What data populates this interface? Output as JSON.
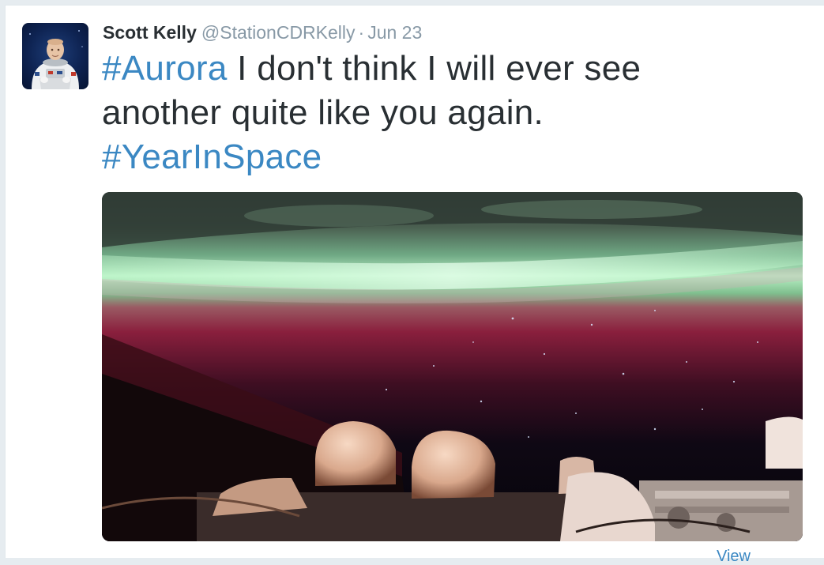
{
  "tweet": {
    "author_name": "Scott Kelly",
    "author_handle": "@StationCDRKelly",
    "separator": "·",
    "date": "Jun 23",
    "text_parts": {
      "hashtag_1": "#Aurora",
      "body": " I don't think I will ever see another quite like you again.",
      "hashtag_2": "#YearInSpace"
    },
    "media_kind": "aurora-photo",
    "view_link_partial": "View"
  },
  "colors": {
    "link": "#3b88c3",
    "text": "#292f33",
    "muted": "#8899a6",
    "background": "#ffffff"
  },
  "icons": {
    "avatar": "astronaut-profile-photo"
  }
}
